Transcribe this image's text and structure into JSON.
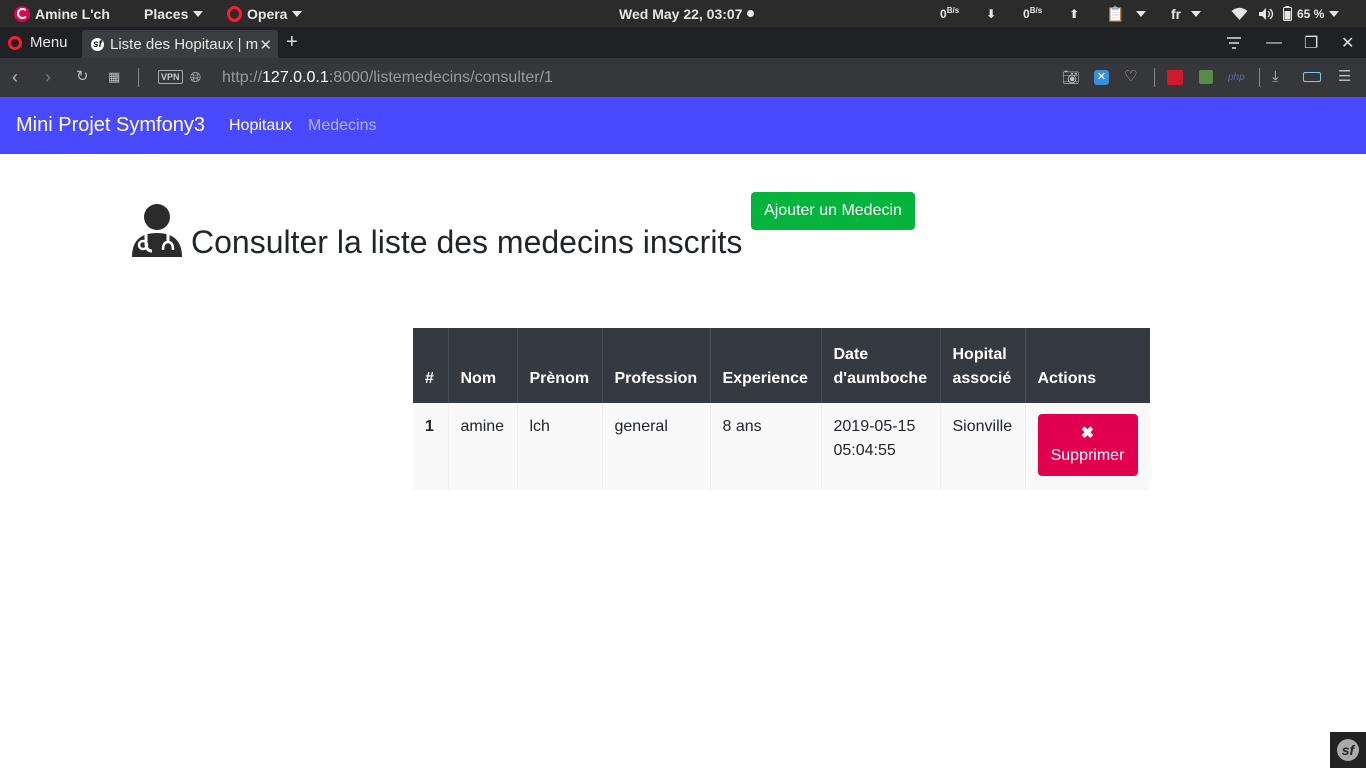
{
  "system_bar": {
    "user": "Amine L'ch",
    "places": "Places",
    "app": "Opera",
    "clock": "Wed May 22, 03:07",
    "net_down_value": "0",
    "net_down_unit": "B/s",
    "net_up_value": "0",
    "net_up_unit": "B/s",
    "language": "fr",
    "battery": "65 %"
  },
  "browser": {
    "menu_label": "Menu",
    "tab_title": "Liste des Hopitaux | m",
    "vpn_label": "VPN",
    "url_prefix": "http://",
    "url_host": "127.0.0.1",
    "url_path": ":8000/listemedecins/consulter/1"
  },
  "navbar": {
    "brand": "Mini Projet Symfony3",
    "links": [
      {
        "label": "Hopitaux",
        "active": true
      },
      {
        "label": "Medecins",
        "active": false
      }
    ],
    "color": "#4949ff"
  },
  "main": {
    "title": "Consulter la liste des medecins inscrits",
    "add_button": "Ajouter un Medecin",
    "add_button_color": "#05b43d"
  },
  "table": {
    "headers": [
      "#",
      "Nom",
      "Prènom",
      "Profession",
      "Experience",
      "Date d'aumboche",
      "Hopital associé",
      "Actions"
    ],
    "rows": [
      {
        "id": "1",
        "nom": "amine",
        "prenom": "lch",
        "profession": "general",
        "experience": "8 ans",
        "date_line1": "2019-05-15",
        "date_line2": "05:04:55",
        "hopital": "Sionville",
        "action_label": "Supprimer",
        "action_icon": "✖"
      }
    ],
    "delete_color": "#e0004d"
  },
  "symfony_toolbar": {
    "icon": "sf"
  }
}
